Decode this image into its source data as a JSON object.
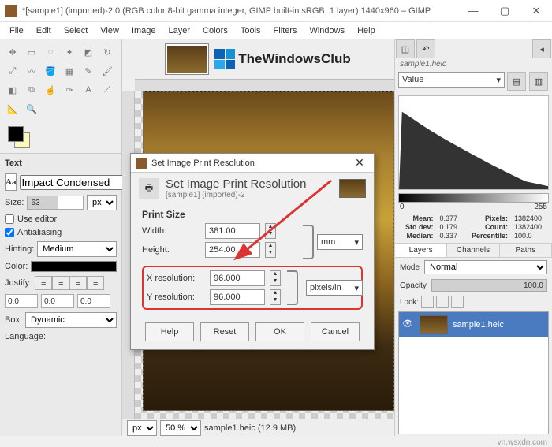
{
  "title": "*[sample1] (imported)-2.0 (RGB color 8-bit gamma integer, GIMP built-in sRGB, 1 layer) 1440x960 – GIMP",
  "menu": [
    "File",
    "Edit",
    "Select",
    "View",
    "Image",
    "Layer",
    "Colors",
    "Tools",
    "Filters",
    "Windows",
    "Help"
  ],
  "toolbox": {
    "text_section": "Text",
    "font_label": "Font",
    "font_value": "Impact Condensed",
    "size_label": "Size:",
    "size_value": "63",
    "size_unit": "px",
    "use_editor": "Use editor",
    "antialias": "Antialiasing",
    "hinting_label": "Hinting:",
    "hinting_value": "Medium",
    "color_label": "Color:",
    "justify_label": "Justify:",
    "box_label": "Box:",
    "box_value": "Dynamic",
    "spin0": "0.0",
    "spin1": "0.0",
    "spin2": "0.0",
    "lang_label": "Language:"
  },
  "logo_text": "TheWindowsClub",
  "canvas_foot": {
    "unit": "px",
    "zoom": "50 %",
    "status": "sample1.heic (12.9 MB)"
  },
  "right": {
    "filename": "sample1.heic",
    "channel": "Value",
    "range_lo": "0",
    "range_hi": "255",
    "stats": {
      "mean_l": "Mean:",
      "mean_v": "0.377",
      "std_l": "Std dev:",
      "std_v": "0.179",
      "med_l": "Median:",
      "med_v": "0.337",
      "pix_l": "Pixels:",
      "pix_v": "1382400",
      "cnt_l": "Count:",
      "cnt_v": "1382400",
      "pct_l": "Percentile:",
      "pct_v": "100.0"
    },
    "tabs": [
      "Layers",
      "Channels",
      "Paths"
    ],
    "mode_l": "Mode",
    "mode_v": "Normal",
    "opac_l": "Opacity",
    "opac_v": "100.0",
    "lock_l": "Lock:",
    "layer_name": "sample1.heic"
  },
  "dialog": {
    "title": "Set Image Print Resolution",
    "heading": "Set Image Print Resolution",
    "sub": "[sample1] (imported)-2",
    "group": "Print Size",
    "width_l": "Width:",
    "width_v": "381.00",
    "height_l": "Height:",
    "height_v": "254.00",
    "size_unit": "mm",
    "xres_l": "X resolution:",
    "xres_v": "96.000",
    "yres_l": "Y resolution:",
    "yres_v": "96.000",
    "res_unit": "pixels/in",
    "buttons": [
      "Help",
      "Reset",
      "OK",
      "Cancel"
    ]
  },
  "watermark": "vn.wsxdn.com"
}
